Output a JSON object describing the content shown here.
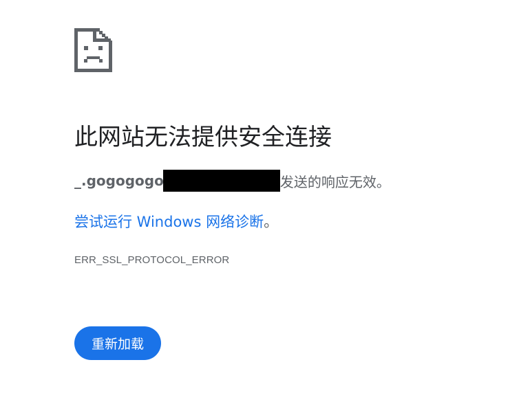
{
  "icon": "sad-page-icon",
  "heading": "此网站无法提供安全连接",
  "description": {
    "host": "_.gogogogo",
    "suffix": "发送的响应无效。"
  },
  "diagnostics": {
    "link_text": "尝试运行 Windows 网络诊断",
    "trailing": "。"
  },
  "error_code": "ERR_SSL_PROTOCOL_ERROR",
  "reload_button": "重新加载",
  "colors": {
    "accent": "#1a73e8",
    "heading": "#202124",
    "secondary_text": "#5f6368"
  }
}
